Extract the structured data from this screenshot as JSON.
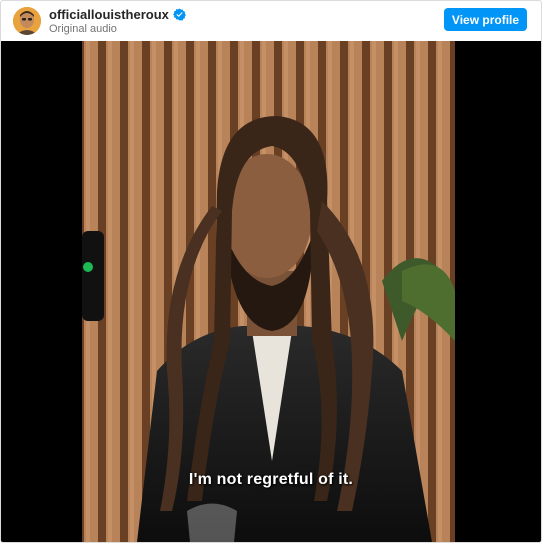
{
  "header": {
    "username": "officiallouistheroux",
    "subtitle": "Original audio",
    "view_profile_label": "View profile"
  },
  "video": {
    "caption": "I'm not regretful of it."
  },
  "icons": {
    "verified": "verified-badge-icon",
    "avatar": "profile-avatar"
  },
  "colors": {
    "accent": "#0095f6",
    "username": "#262626",
    "subtitle": "#737373",
    "caption": "#ffffff"
  }
}
